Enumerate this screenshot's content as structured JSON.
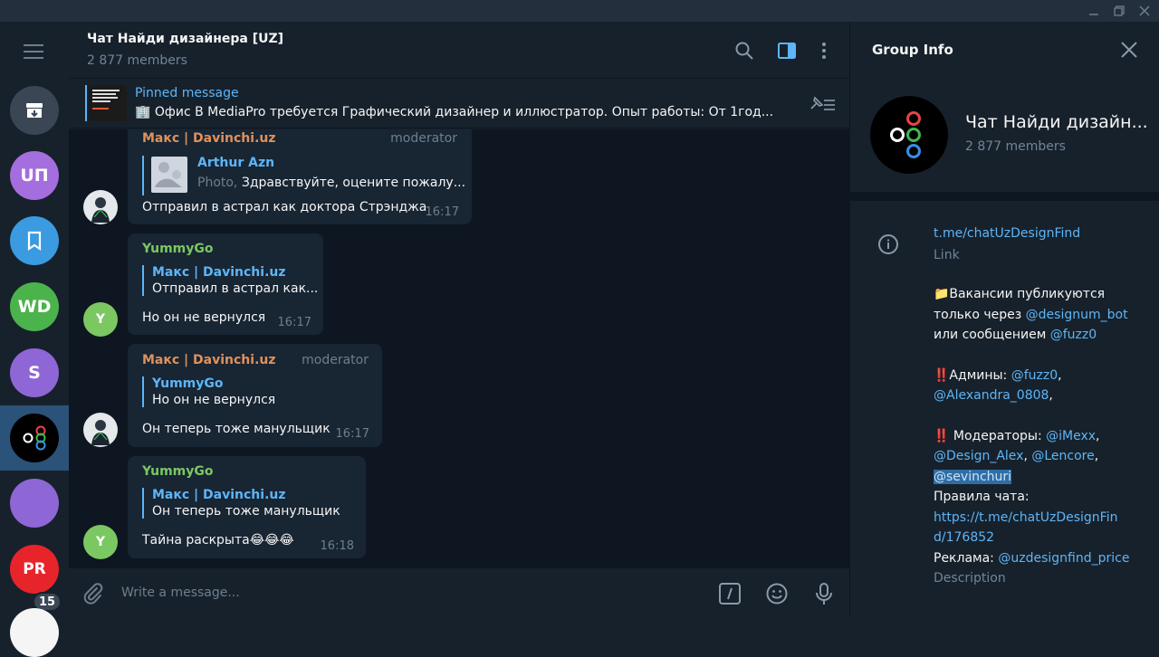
{
  "chat": {
    "title": "Чат Найди дизайнера [UZ]",
    "members": "2 877 members"
  },
  "pinned": {
    "title": "Pinned message",
    "text": "🏢 Офис     В  MediaPro требуется Графический дизайнер и иллюстратор.   Опыт работы: От 1год..."
  },
  "sidebar": {
    "chats": [
      {
        "label": "",
        "color": "#3b4654"
      },
      {
        "label": "UП",
        "color": "#a46ede"
      },
      {
        "label": "",
        "color": "#3a9be0"
      },
      {
        "label": "WD",
        "color": "#4bb34b"
      },
      {
        "label": "S",
        "color": "#8e66d6"
      },
      {
        "label": "",
        "color": "#000000"
      },
      {
        "label": "",
        "color": "#8e66d6"
      },
      {
        "label": "PR",
        "color": "#e8242b"
      }
    ],
    "unread_badge": "15"
  },
  "messages": [
    {
      "sender": "Макс | Davinchi.uz",
      "role": "moderator",
      "reply_name": "Arthur Azn",
      "reply_prefix": "Photo, ",
      "reply_text": "Здравствуйте, оцените пожалу...",
      "text": "Отправил в астрал как доктора Стрэнджа",
      "time": "16:17"
    },
    {
      "sender": "YummyGo",
      "avatar_letter": "Y",
      "reply_name": "Макс | Davinchi.uz",
      "reply_text": "Отправил в астрал как...",
      "text": "Но он не вернулся",
      "time": "16:17"
    },
    {
      "sender": "Макс | Davinchi.uz",
      "role": "moderator",
      "reply_name": "YummyGo",
      "reply_text": "Но он не вернулся",
      "text": "Он теперь тоже манульщик",
      "time": "16:17"
    },
    {
      "sender": "YummyGo",
      "avatar_letter": "Y",
      "reply_name": "Макс | Davinchi.uz",
      "reply_text": "Он теперь тоже манульщик",
      "text": "Тайна раскрыта😂😂😂",
      "time": "16:18"
    }
  ],
  "composer": {
    "placeholder": "Write a message..."
  },
  "info": {
    "panel_title": "Group Info",
    "name": "Чат Найди дизайн...",
    "members": "2 877 members",
    "link": "t.me/chatUzDesignFind",
    "link_label": "Link",
    "desc_line1": "📁Вакансии публикуются",
    "desc_line2a": "только через ",
    "desc_handle1": "@designum_bot",
    "desc_line3a": "или сообщением ",
    "desc_handle2": "@fuzz0",
    "admins_label": "‼️Админы: ",
    "admin1": "@fuzz0",
    "admin1_sep": ",",
    "admin2": "@Alexandra_0808",
    "admin2_sep": ",",
    "mods_label": "‼️ Модераторы: ",
    "mod1": "@iMexx",
    "mod1_sep": ",",
    "mod2": "@Design_Alex",
    "mod2_sep": ", ",
    "mod3": "@Lencore",
    "mod3_sep": ",",
    "mod4": "@sevinchuri",
    "rules_label": "Правила чата:",
    "rules_link1": "https://t.me/chatUzDesignFin",
    "rules_link2": "d/176852",
    "ads_label": "Реклама: ",
    "ads_handle": "@uzdesignfind_price",
    "desc_label": "Description"
  },
  "colors": {
    "accent": "#5eb5f7",
    "sender_moderator": "#e0915a",
    "sender_yummy": "#7bc862",
    "bubble": "#182533",
    "chat_bg": "#0e1621",
    "panel_bg": "#17212b"
  }
}
